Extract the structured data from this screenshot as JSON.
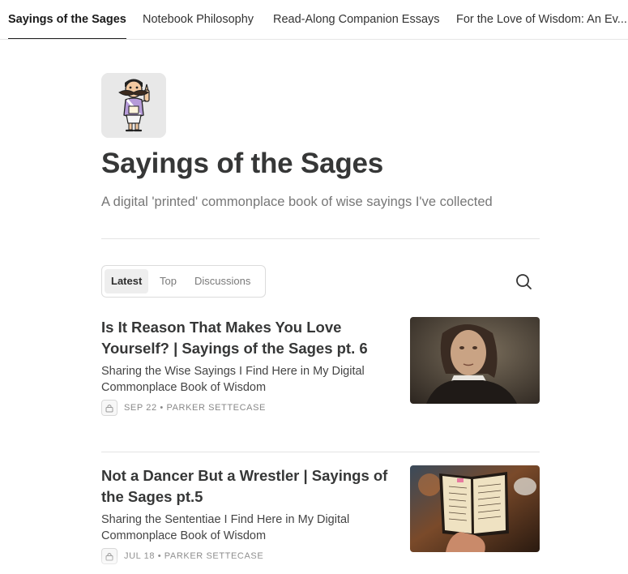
{
  "nav": {
    "tabs": [
      {
        "label": "Sayings of the Sages"
      },
      {
        "label": "Notebook Philosophy"
      },
      {
        "label": "Read-Along Companion Essays"
      },
      {
        "label": "For the Love of Wisdom: An Ev..."
      }
    ]
  },
  "publication": {
    "title": "Sayings of the Sages",
    "description": "A digital 'printed' commonplace book of wise sayings I've collected"
  },
  "filters": {
    "items": [
      {
        "label": "Latest"
      },
      {
        "label": "Top"
      },
      {
        "label": "Discussions"
      }
    ],
    "active": "Latest"
  },
  "search": {
    "icon": "search-icon"
  },
  "posts": [
    {
      "title": "Is It Reason That Makes You Love Yourself? | Sayings of the Sages pt. 6",
      "subtitle": "Sharing the Wise Sayings I Find Here in My Digital Commonplace Book of Wisdom",
      "meta": "SEP 22 • PARKER SETTECASE",
      "lock_icon": "lock-icon",
      "thumbnail": "portrait-painting"
    },
    {
      "title": "Not a Dancer But a Wrestler | Sayings of the Sages pt.5",
      "subtitle": "Sharing the Sententiae I Find Here in My Digital Commonplace Book of Wisdom",
      "meta": "JUL 18 • PARKER SETTECASE",
      "lock_icon": "lock-icon",
      "thumbnail": "open-notebook-photo"
    }
  ],
  "colors": {
    "title": "#363737",
    "muted": "#777777",
    "divider": "#e3e3e3",
    "active_underline": "#222222"
  }
}
